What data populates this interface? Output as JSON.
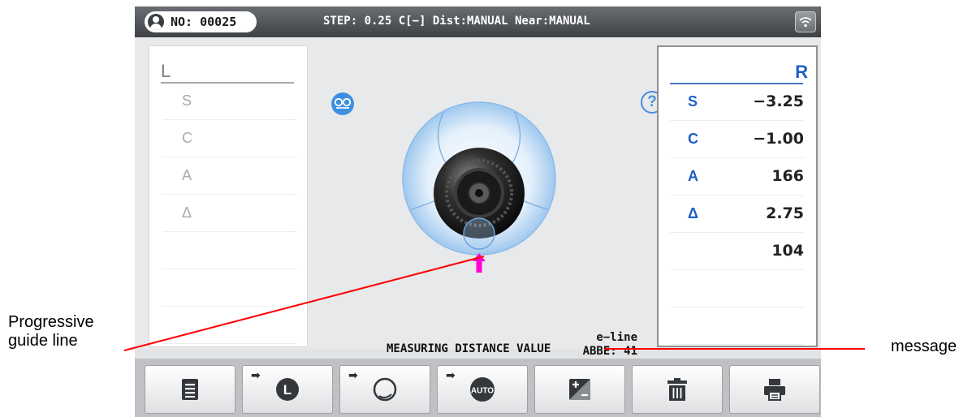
{
  "header": {
    "patient_no": "NO: 00025",
    "status": "STEP: 0.25   C[−]  Dist:MANUAL  Near:MANUAL"
  },
  "left_panel": {
    "title": "L",
    "labels": [
      "S",
      "C",
      "A",
      "Δ"
    ]
  },
  "right_panel": {
    "title": "R",
    "rows": [
      {
        "label": "S",
        "value": "−3.25"
      },
      {
        "label": "C",
        "value": "−1.00"
      },
      {
        "label": "A",
        "value": "166"
      },
      {
        "label": "Δ",
        "value": "2.75"
      },
      {
        "label": "",
        "value": "104"
      }
    ]
  },
  "measure": {
    "line_name": "e−line",
    "abbe": "ABBE: 41",
    "message": "MEASURING DISTANCE VALUE"
  },
  "help_symbol": "?",
  "toolbar": [
    {
      "icon": "list-icon"
    },
    {
      "icon": "switch-left-lens-icon",
      "arrow": "➡",
      "badge": "L"
    },
    {
      "icon": "switch-contact-lens-icon",
      "arrow": "➡"
    },
    {
      "icon": "switch-auto-mode-icon",
      "arrow": "➡",
      "badge": "AUTO"
    },
    {
      "icon": "add-subtract-icon"
    },
    {
      "icon": "delete-trash-icon"
    },
    {
      "icon": "print-icon"
    }
  ],
  "annotations": {
    "left_label_line1": "Progressive",
    "left_label_line2": "guide line",
    "right_label": "message"
  },
  "colors": {
    "accent_blue": "#1e5fc8",
    "guide_arrow": "#ff00d4",
    "callout_line": "#ff0000"
  }
}
